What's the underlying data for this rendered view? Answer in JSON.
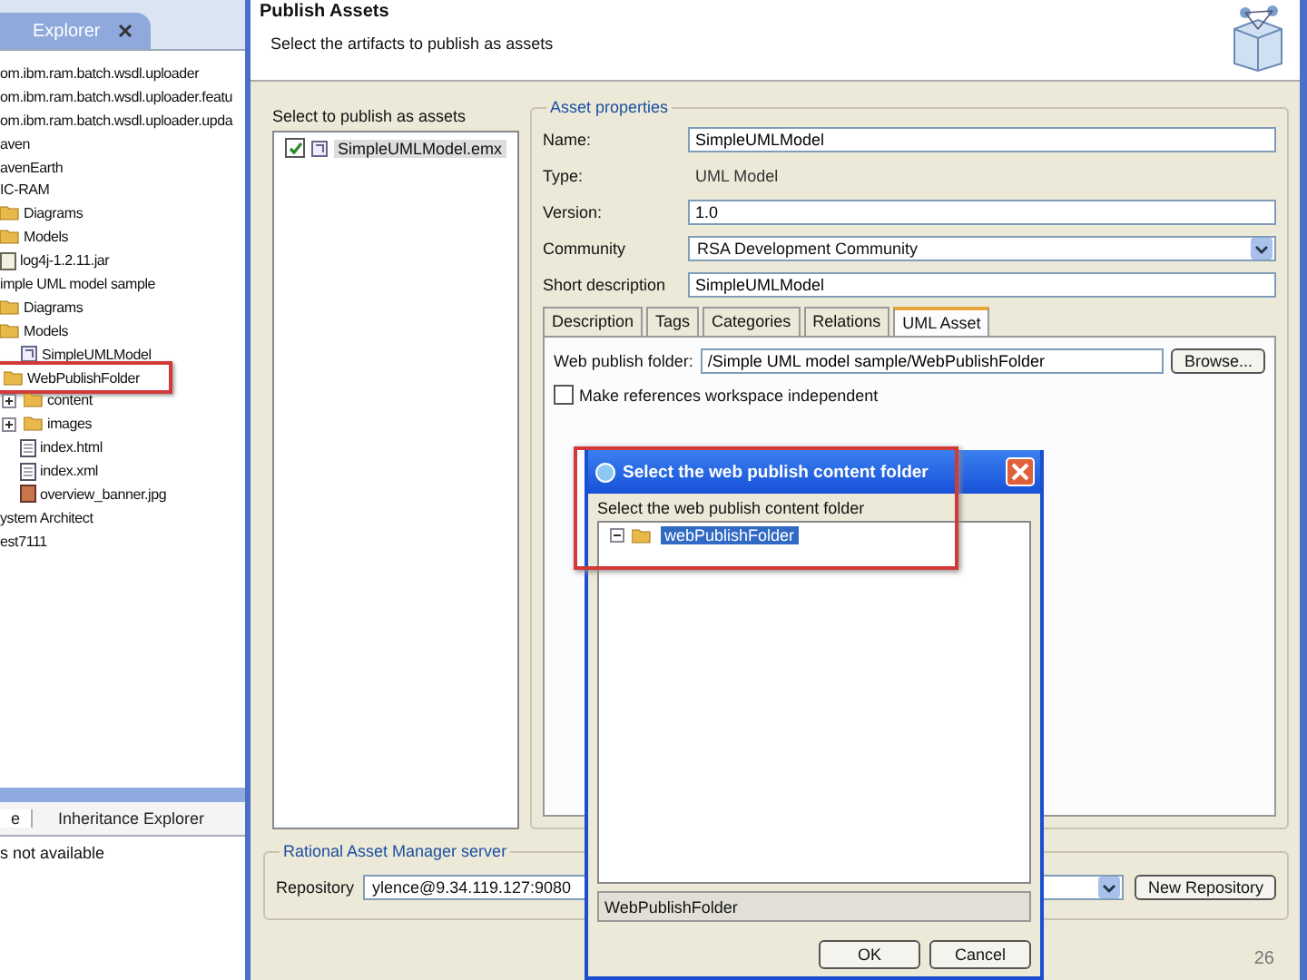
{
  "explorer": {
    "tab": "Explorer",
    "tree": [
      {
        "label": "om.ibm.ram.batch.wsdl.uploader"
      },
      {
        "label": "om.ibm.ram.batch.wsdl.uploader.featu"
      },
      {
        "label": "om.ibm.ram.batch.wsdl.uploader.upda"
      },
      {
        "label": "aven"
      },
      {
        "label": "avenEarth"
      },
      {
        "label": "IC-RAM",
        "children": [
          {
            "label": "Diagrams",
            "kind": "folder"
          },
          {
            "label": "Models",
            "kind": "folder"
          },
          {
            "label": "log4j-1.2.11.jar",
            "kind": "jar"
          }
        ]
      },
      {
        "label": "imple UML model sample",
        "children": [
          {
            "label": "Diagrams",
            "kind": "folder"
          },
          {
            "label": "Models",
            "kind": "folder",
            "children": [
              {
                "label": "SimpleUMLModel",
                "kind": "model"
              }
            ]
          },
          {
            "label": "WebPublishFolder",
            "kind": "folder",
            "highlighted": true,
            "children": [
              {
                "label": "content",
                "kind": "folder",
                "expanded": false
              },
              {
                "label": "images",
                "kind": "folder",
                "expanded": false
              },
              {
                "label": "index.html",
                "kind": "file"
              },
              {
                "label": "index.xml",
                "kind": "file"
              },
              {
                "label": "overview_banner.jpg",
                "kind": "image"
              }
            ]
          }
        ]
      },
      {
        "label": "ystem Architect"
      },
      {
        "label": "est7111"
      }
    ],
    "bottom_tabs": [
      {
        "label": "e",
        "selected": true
      },
      {
        "label": "Inheritance Explorer",
        "selected": false
      }
    ],
    "bottom_message": "s not available"
  },
  "wizard": {
    "title": "Publish Assets",
    "subtitle": "Select the artifacts to publish as assets",
    "artifacts_label": "Select to publish as assets",
    "artifacts": [
      {
        "label": "SimpleUMLModel.emx",
        "checked": true
      }
    ],
    "group_title": "Asset properties",
    "properties": [
      {
        "kind": "field",
        "label": "Name:",
        "value": "SimpleUMLModel"
      },
      {
        "kind": "text",
        "label": "Type:",
        "value": "UML Model"
      },
      {
        "kind": "field",
        "label": "Version:",
        "value": "1.0"
      },
      {
        "kind": "combo",
        "label": "Community",
        "value": "RSA Development Community"
      },
      {
        "kind": "field",
        "label": "Short description",
        "value": "SimpleUMLModel"
      }
    ],
    "tabs": [
      {
        "label": "Description",
        "selected": false
      },
      {
        "label": "Tags",
        "selected": false
      },
      {
        "label": "Categories",
        "selected": false
      },
      {
        "label": "Relations",
        "selected": false
      },
      {
        "label": "UML Asset",
        "selected": true
      }
    ],
    "web_folder_label": "Web publish folder:",
    "web_folder_value": "/Simple UML model sample/WebPublishFolder",
    "browse_button": "Browse...",
    "workspace_checkbox": {
      "label": "Make references workspace independent",
      "checked": false
    },
    "server_group_title": "Rational Asset Manager server",
    "repository_label": "Repository",
    "repository_value": "ylence@9.34.119.127:9080",
    "new_repository_button": "New Repository"
  },
  "folder_dialog": {
    "title": "Select the web publish content folder",
    "highlighted": true,
    "prompt": "Select the web publish content folder",
    "tree": [
      {
        "label": "webPublishFolder",
        "selected": true
      }
    ],
    "value": "WebPublishFolder",
    "buttons": [
      "OK",
      "Cancel"
    ]
  },
  "slide_number": "26"
}
